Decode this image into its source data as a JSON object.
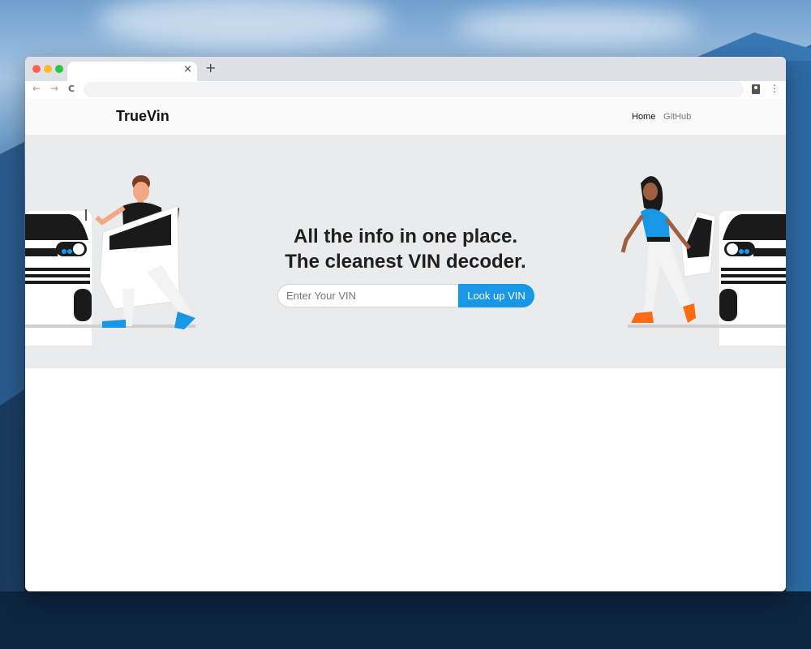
{
  "browser": {
    "tab_title": "",
    "new_tab_symbol": "+",
    "close_tab_symbol": "×",
    "back_symbol": "←",
    "forward_symbol": "→",
    "reload_symbol": "C",
    "menu_symbol": "⋮",
    "url": ""
  },
  "site": {
    "brand": "TrueVin",
    "nav": [
      "Home",
      "GitHub"
    ]
  },
  "hero": {
    "headline_line1": "All the info in one place.",
    "headline_line2": "The cleanest VIN decoder.",
    "vin_placeholder": "Enter Your VIN",
    "button_label": "Look up VIN"
  },
  "colors": {
    "accent": "#1797e6",
    "hero_bg": "#e9ebed",
    "header_bg": "#fafafa",
    "shoe_left": "#1797e6",
    "shoe_right": "#ff6a13"
  }
}
